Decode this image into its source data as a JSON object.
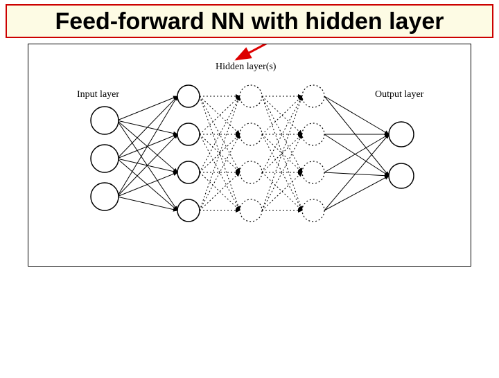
{
  "title": "Feed-forward NN with hidden layer",
  "labels": {
    "input": "Input layer",
    "hidden": "Hidden layer(s)",
    "output": "Output layer"
  },
  "network": {
    "input_nodes": 3,
    "hidden1_nodes": 4,
    "hidden2_nodes": 4,
    "hidden3_nodes": 4,
    "output_nodes": 2,
    "solid_layers": [
      "input",
      "hidden1",
      "output"
    ],
    "dotted_layers": [
      "hidden2",
      "hidden3"
    ],
    "solid_connections": [
      [
        "input",
        "hidden1"
      ],
      [
        "hidden3",
        "output"
      ]
    ],
    "dotted_connections": [
      [
        "hidden1",
        "hidden2"
      ],
      [
        "hidden2",
        "hidden3"
      ]
    ],
    "arrow_from_title_to": "hidden"
  }
}
